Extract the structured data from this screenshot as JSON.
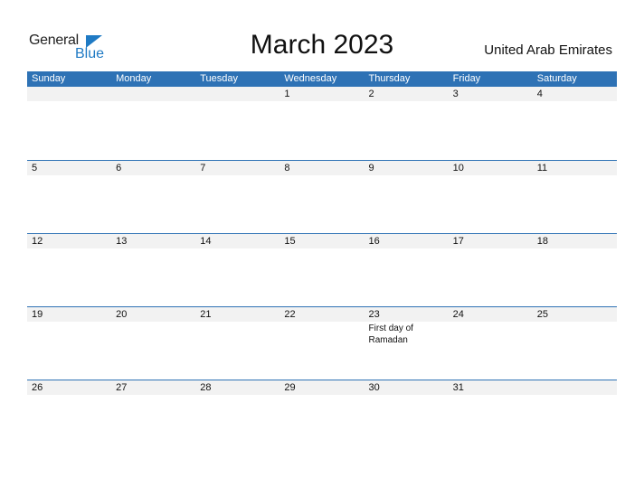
{
  "logo": {
    "general": "General",
    "blue": "Blue",
    "accent_color": "#1f7ac4"
  },
  "title": "March 2023",
  "country": "United Arab Emirates",
  "header_color": "#2e72b5",
  "days": [
    "Sunday",
    "Monday",
    "Tuesday",
    "Wednesday",
    "Thursday",
    "Friday",
    "Saturday"
  ],
  "weeks": [
    [
      {
        "d": ""
      },
      {
        "d": ""
      },
      {
        "d": ""
      },
      {
        "d": "1"
      },
      {
        "d": "2"
      },
      {
        "d": "3"
      },
      {
        "d": "4"
      }
    ],
    [
      {
        "d": "5"
      },
      {
        "d": "6"
      },
      {
        "d": "7"
      },
      {
        "d": "8"
      },
      {
        "d": "9"
      },
      {
        "d": "10"
      },
      {
        "d": "11"
      }
    ],
    [
      {
        "d": "12"
      },
      {
        "d": "13"
      },
      {
        "d": "14"
      },
      {
        "d": "15"
      },
      {
        "d": "16"
      },
      {
        "d": "17"
      },
      {
        "d": "18"
      }
    ],
    [
      {
        "d": "19"
      },
      {
        "d": "20"
      },
      {
        "d": "21"
      },
      {
        "d": "22"
      },
      {
        "d": "23",
        "event": "First day of Ramadan"
      },
      {
        "d": "24"
      },
      {
        "d": "25"
      }
    ],
    [
      {
        "d": "26"
      },
      {
        "d": "27"
      },
      {
        "d": "28"
      },
      {
        "d": "29"
      },
      {
        "d": "30"
      },
      {
        "d": "31"
      },
      {
        "d": ""
      }
    ]
  ]
}
